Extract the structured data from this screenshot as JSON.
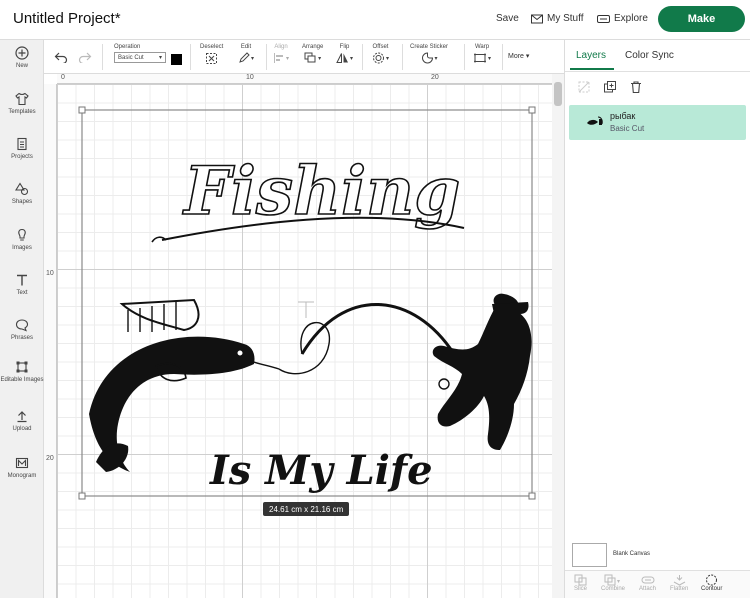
{
  "app": {
    "title": "Untitled Project*",
    "save": "Save",
    "my_stuff": "My Stuff",
    "explore": "Explore",
    "make": "Make",
    "accent": "#117a4a"
  },
  "rail": [
    {
      "label": "New",
      "icon": "plus-circle-icon"
    },
    {
      "label": "Templates",
      "icon": "shirt-icon"
    },
    {
      "label": "Projects",
      "icon": "projects-icon"
    },
    {
      "label": "Shapes",
      "icon": "shapes-icon"
    },
    {
      "label": "Images",
      "icon": "bulb-icon"
    },
    {
      "label": "Text",
      "icon": "text-icon"
    },
    {
      "label": "Phrases",
      "icon": "speech-icon"
    },
    {
      "label": "Editable Images",
      "icon": "editable-images-icon"
    },
    {
      "label": "Upload",
      "icon": "upload-icon"
    },
    {
      "label": "Monogram",
      "icon": "monogram-icon"
    }
  ],
  "toolbar": {
    "operation_label": "Operation",
    "operation_value": "Basic Cut",
    "deselect": "Deselect",
    "edit": "Edit",
    "align": "Align",
    "arrange": "Arrange",
    "flip": "Flip",
    "offset": "Offset",
    "create_sticker": "Create Sticker",
    "warp": "Warp",
    "more": "More"
  },
  "canvas": {
    "ruler_top": [
      "0",
      "10",
      "20"
    ],
    "ruler_left": [
      "10",
      "20"
    ],
    "dimensions": "24.61  cm x 21.16  cm",
    "heading": "Fishing",
    "tagline": "Is My Life"
  },
  "panel": {
    "tab_layers": "Layers",
    "tab_color_sync": "Color Sync",
    "layer_name": "рыбак",
    "layer_sub": "Basic Cut",
    "blank_canvas": "Blank Canvas",
    "bottom": [
      "Slice",
      "Combine",
      "Attach",
      "Flatten",
      "Contour"
    ]
  }
}
